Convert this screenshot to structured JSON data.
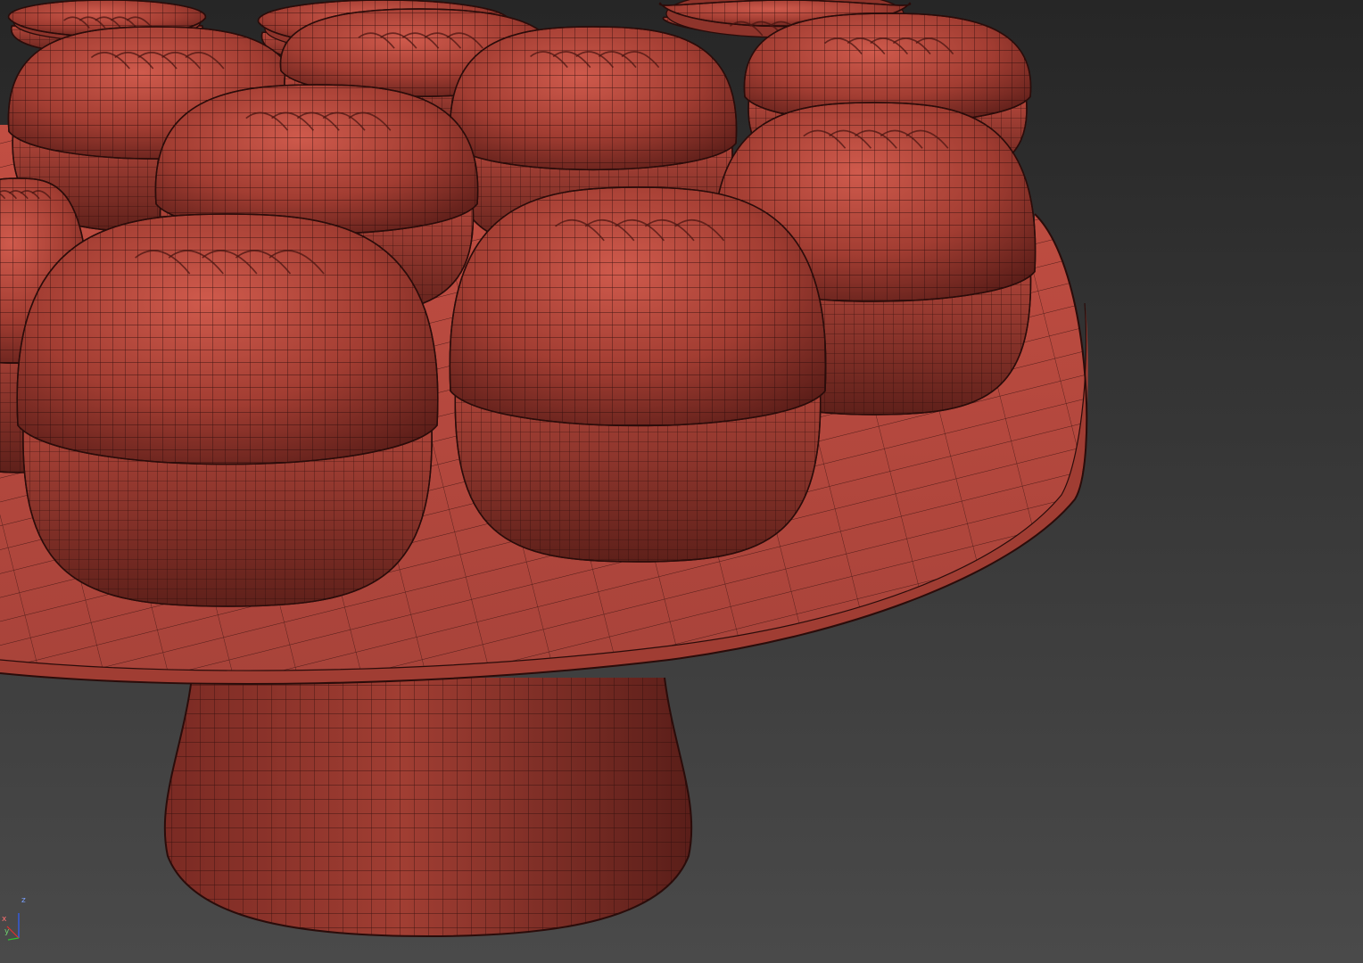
{
  "viewport": {
    "background_top": "#2a2a2a",
    "background_bottom": "#4a4a4a",
    "shading_mode": "edged-faces"
  },
  "scene": {
    "object": "cake-stand-with-macarons",
    "material_color": "#b8473c",
    "material_highlight": "#d35a4e",
    "material_shadow": "#5c1f1a",
    "wire_color": "#2a0c0a"
  },
  "gizmo": {
    "axis_z": "z",
    "axis_x": "x",
    "axis_y": "y",
    "color_x": "#e03030",
    "color_y": "#30c030",
    "color_z": "#3060ff"
  }
}
